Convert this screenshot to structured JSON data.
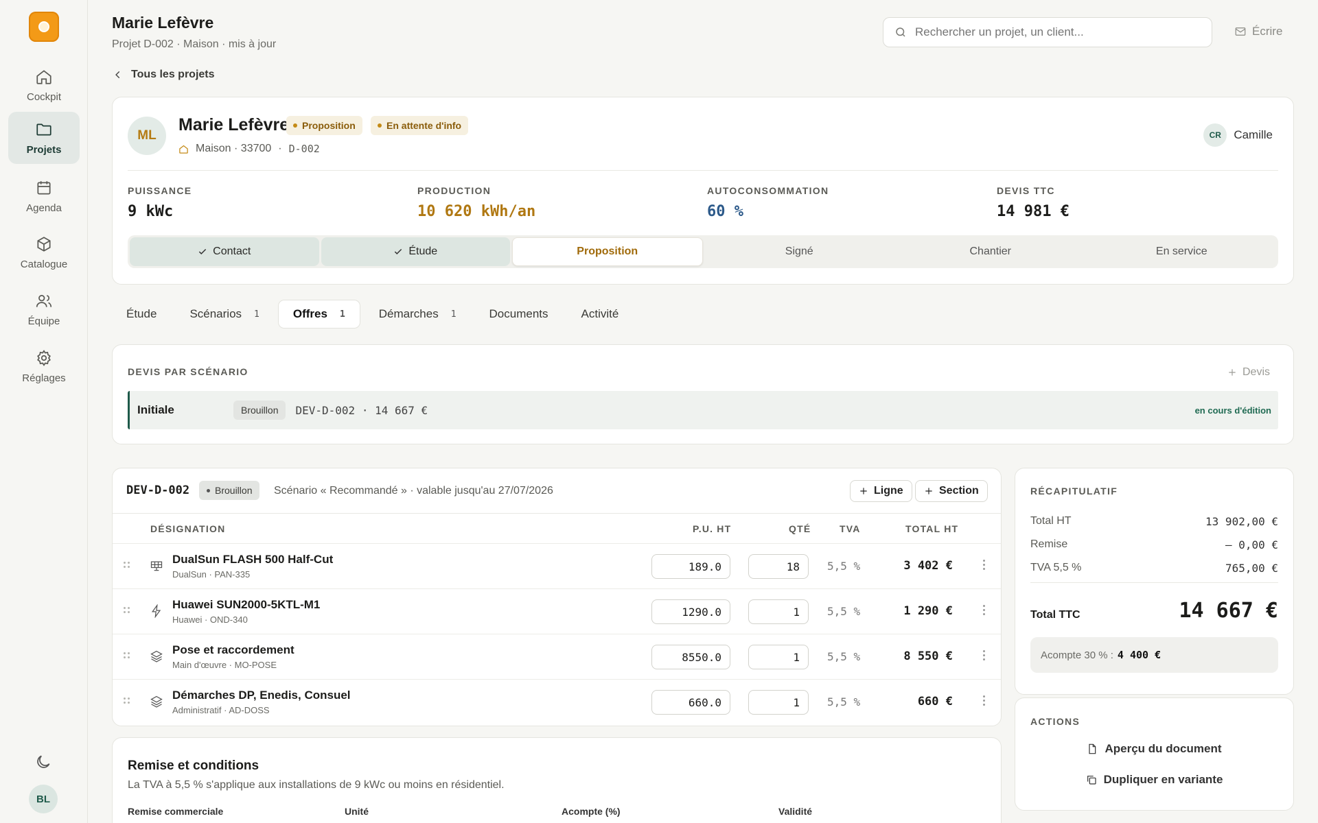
{
  "sidebar": {
    "items": [
      {
        "label": "Cockpit",
        "icon": "home-icon"
      },
      {
        "label": "Projets",
        "icon": "folder-icon",
        "active": true
      },
      {
        "label": "Agenda",
        "icon": "calendar-icon"
      },
      {
        "label": "Catalogue",
        "icon": "box-icon"
      },
      {
        "label": "Équipe",
        "icon": "users-icon"
      },
      {
        "label": "Réglages",
        "icon": "gear-icon"
      }
    ],
    "user_initials": "BL"
  },
  "header": {
    "title": "Marie Lefèvre",
    "subtitle": "Projet D-002 · Maison · mis à jour",
    "search_placeholder": "Rechercher un projet, un client...",
    "write_label": "Écrire"
  },
  "back_label": "Tous les projets",
  "project": {
    "initials": "ML",
    "client_name": "Marie Lefèvre",
    "badges": [
      "Proposition",
      "En attente d'info"
    ],
    "location": "Maison · 33700",
    "sep": "·",
    "reference": "D-002",
    "assignee_initials": "CR",
    "assignee_name": "Camille",
    "kpis": [
      {
        "label": "PUISSANCE",
        "value": "9 kWc",
        "color": "#1c1c1a"
      },
      {
        "label": "PRODUCTION",
        "value": "10 620 kWh/an",
        "color": "#b07812"
      },
      {
        "label": "AUTOCONSOMMATION",
        "value": "60 %",
        "color": "#2d5a8a"
      },
      {
        "label": "DEVIS TTC",
        "value": "14 981 €",
        "color": "#1c1c1a"
      }
    ],
    "steps": [
      {
        "label": "Contact",
        "state": "done"
      },
      {
        "label": "Étude",
        "state": "done"
      },
      {
        "label": "Proposition",
        "state": "current"
      },
      {
        "label": "Signé",
        "state": "todo"
      },
      {
        "label": "Chantier",
        "state": "todo"
      },
      {
        "label": "En service",
        "state": "todo"
      }
    ]
  },
  "tabs": [
    {
      "label": "Étude",
      "count": ""
    },
    {
      "label": "Scénarios",
      "count": "1"
    },
    {
      "label": "Offres",
      "count": "1",
      "active": true
    },
    {
      "label": "Démarches",
      "count": "1"
    },
    {
      "label": "Documents",
      "count": ""
    },
    {
      "label": "Activité",
      "count": ""
    }
  ],
  "devis_par_scenario": {
    "title": "DEVIS PAR SCÉNARIO",
    "add_label": "Devis",
    "row": {
      "scenario": "Initiale",
      "status": "Brouillon",
      "reference": "DEV-D-002 · 14 667 €",
      "edit_status": "en cours d'édition"
    }
  },
  "quote": {
    "id": "DEV-D-002",
    "status": "Brouillon",
    "meta": "Scénario « Recommandé » · valable jusqu'au 27/07/2026",
    "add_line": "Ligne",
    "add_section": "Section",
    "columns": {
      "designation": "DÉSIGNATION",
      "pu": "P.U. HT",
      "qty": "QTÉ",
      "tva": "TVA",
      "total": "TOTAL HT"
    },
    "lines": [
      {
        "icon": "solar-panel-icon",
        "name": "DualSun FLASH 500 Half-Cut",
        "sub": "DualSun · PAN-335",
        "pu": "189.0",
        "qty": "18",
        "tva": "5,5 %",
        "total": "3 402 €"
      },
      {
        "icon": "lightning-icon",
        "name": "Huawei SUN2000-5KTL-M1",
        "sub": "Huawei · OND-340",
        "pu": "1290.0",
        "qty": "1",
        "tva": "5,5 %",
        "total": "1 290 €"
      },
      {
        "icon": "layers-icon",
        "name": "Pose et raccordement",
        "sub": "Main d'œuvre · MO-POSE",
        "pu": "8550.0",
        "qty": "1",
        "tva": "5,5 %",
        "total": "8 550 €"
      },
      {
        "icon": "layers-icon",
        "name": "Démarches DP, Enedis, Consuel",
        "sub": "Administratif · AD-DOSS",
        "pu": "660.0",
        "qty": "1",
        "tva": "5,5 %",
        "total": "660 €"
      }
    ]
  },
  "recap": {
    "title": "RÉCAPITULATIF",
    "rows": [
      {
        "label": "Total HT",
        "value": "13 902,00 €"
      },
      {
        "label": "Remise",
        "value": "– 0,00 €"
      },
      {
        "label": "TVA 5,5 %",
        "value": "765,00 €"
      }
    ],
    "ttc_label": "Total TTC",
    "ttc_value": "14 667 €",
    "acompte_label": "Acompte 30 % :",
    "acompte_value": "4 400 €"
  },
  "actions": {
    "title": "ACTIONS",
    "preview": "Aperçu du document",
    "duplicate": "Dupliquer en variante"
  },
  "remise": {
    "title": "Remise et conditions",
    "subtitle": "La TVA à 5,5 % s'applique aux installations de 9 kWc ou moins en résidentiel.",
    "columns": [
      "Remise commerciale",
      "Unité",
      "Acompte (%)",
      "Validité"
    ]
  }
}
